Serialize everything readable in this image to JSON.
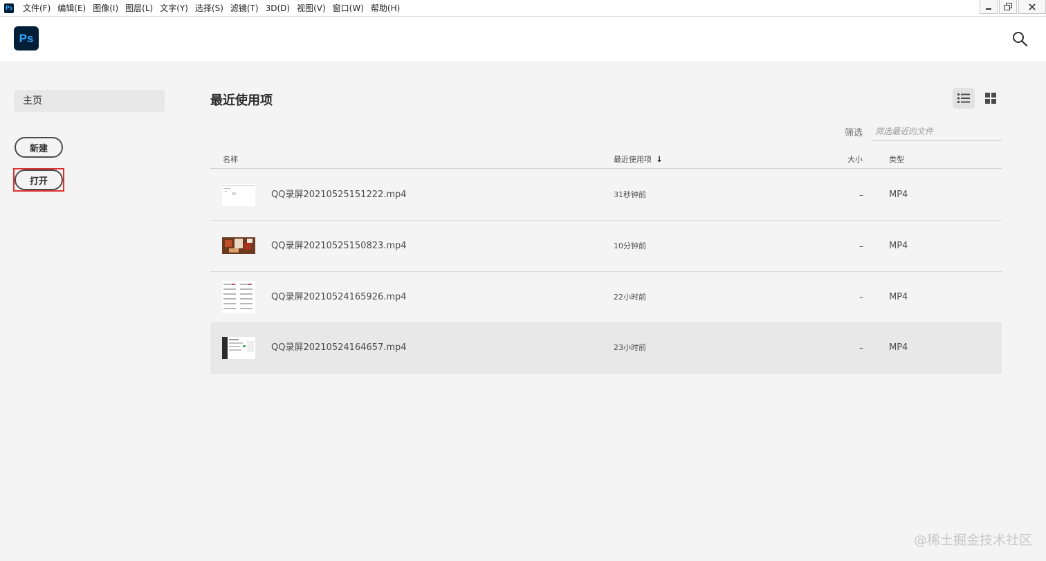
{
  "menubar": {
    "app_icon": "Ps",
    "items": [
      "文件(F)",
      "编辑(E)",
      "图像(I)",
      "图层(L)",
      "文字(Y)",
      "选择(S)",
      "滤镜(T)",
      "3D(D)",
      "视图(V)",
      "窗口(W)",
      "帮助(H)"
    ]
  },
  "header": {
    "logo": "Ps",
    "search_icon": "search-icon"
  },
  "sidebar": {
    "home_label": "主页",
    "new_label": "新建",
    "open_label": "打开"
  },
  "main": {
    "title": "最近使用项",
    "view_modes": [
      "list-view-icon",
      "grid-view-icon"
    ],
    "filter": {
      "label": "筛选",
      "placeholder": "筛选最近的文件"
    },
    "columns": {
      "name": "名称",
      "recent": "最近使用项",
      "size": "大小",
      "type": "类型"
    },
    "files": [
      {
        "name": "QQ录屏20210525151222.mp4",
        "recent": "31秒钟前",
        "size": "–",
        "type": "MP4"
      },
      {
        "name": "QQ录屏20210525150823.mp4",
        "recent": "10分钟前",
        "size": "–",
        "type": "MP4"
      },
      {
        "name": "QQ录屏20210524165926.mp4",
        "recent": "22小时前",
        "size": "–",
        "type": "MP4"
      },
      {
        "name": "QQ录屏20210524164657.mp4",
        "recent": "23小时前",
        "size": "–",
        "type": "MP4"
      }
    ]
  },
  "watermark": "@稀土掘金技术社区",
  "colors": {
    "accent_ps": "#31a8ff",
    "ps_bg": "#001e36",
    "highlight_border": "#e03030",
    "background": "#f4f4f4"
  }
}
